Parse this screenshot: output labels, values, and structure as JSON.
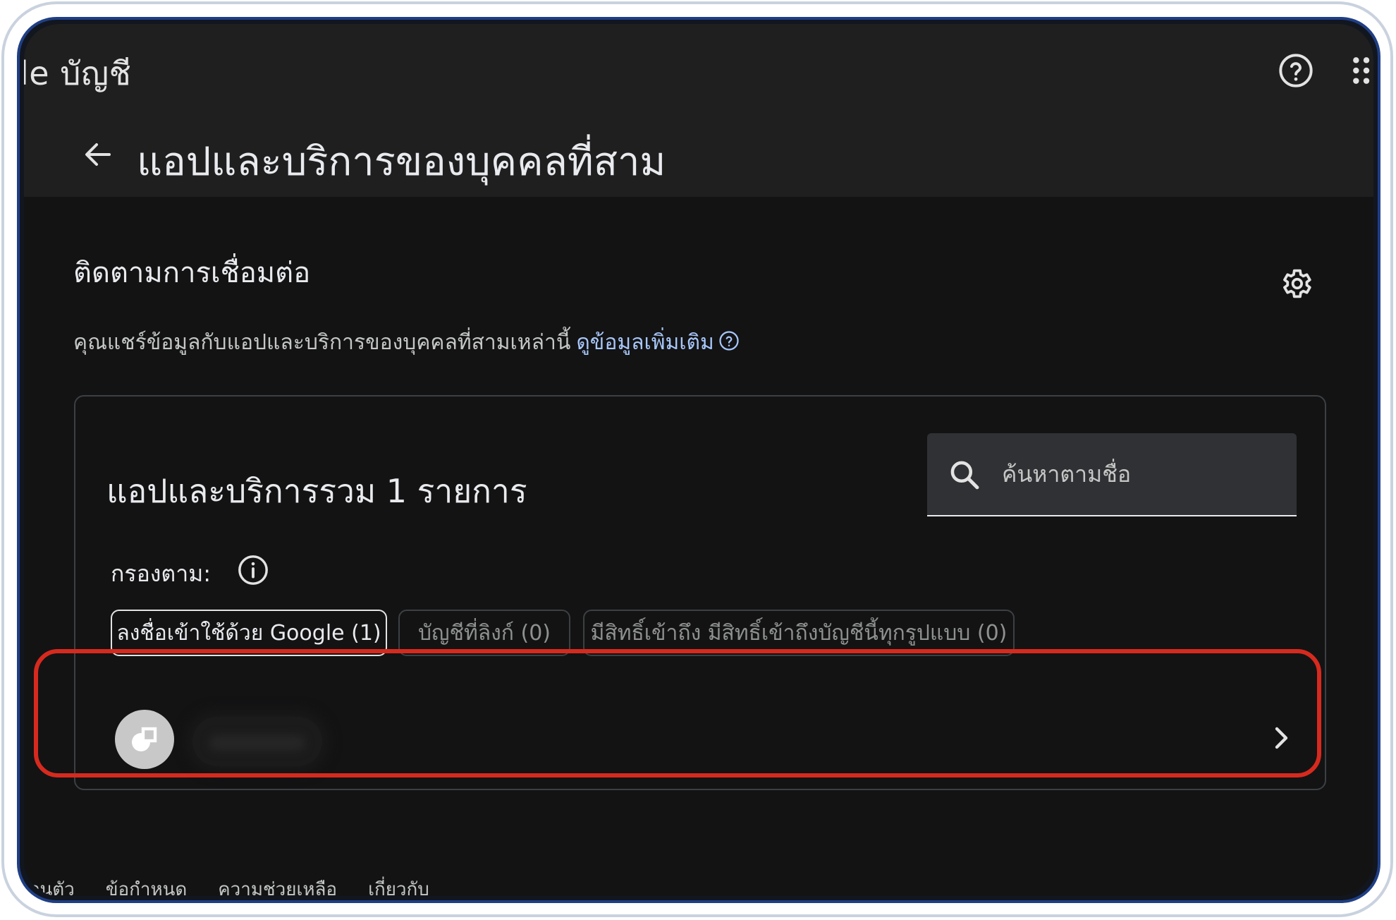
{
  "header": {
    "brand": "le บัญชี",
    "help_icon": "help-circle-icon",
    "apps_icon": "apps-grid-icon",
    "back_icon": "arrow-left-icon",
    "page_title": "แอปและบริการของบุคคลที่สาม"
  },
  "section": {
    "title": "ติดตามการเชื่อมต่อ",
    "settings_icon": "gear-icon",
    "description": "คุณแชร์ข้อมูลกับแอปและบริการของบุคคลที่สามเหล่านี้",
    "learn_more": "ดูข้อมูลเพิ่มเติม"
  },
  "card": {
    "title": "แอปและบริการรวม 1 รายการ",
    "search_placeholder": "ค้นหาตามชื่อ",
    "filter_label": "กรองตาม:",
    "chips": [
      {
        "label": "ลงชื่อเข้าใช้ด้วย Google (1)",
        "state": "selected"
      },
      {
        "label": "บัญชีที่ลิงก์ (0)",
        "state": "disabled"
      },
      {
        "label": "มีสิทธิ์เข้าถึง มีสิทธิ์เข้าถึงบัญชีนี้ทุกรูปแบบ (0)",
        "state": "disabled"
      }
    ]
  },
  "app_row": {
    "avatar_icon": "app-logo-icon",
    "chevron_icon": "chevron-right-icon"
  },
  "footer": {
    "links": [
      "ส่วนตัว",
      "ข้อกำหนด",
      "ความช่วยเหลือ",
      "เกี่ยวกับ"
    ]
  },
  "colors": {
    "background": "#131314",
    "header": "#1f1f20",
    "link": "#a8c7fa",
    "highlight": "#d72a1e",
    "frame": "#1f3f85"
  }
}
